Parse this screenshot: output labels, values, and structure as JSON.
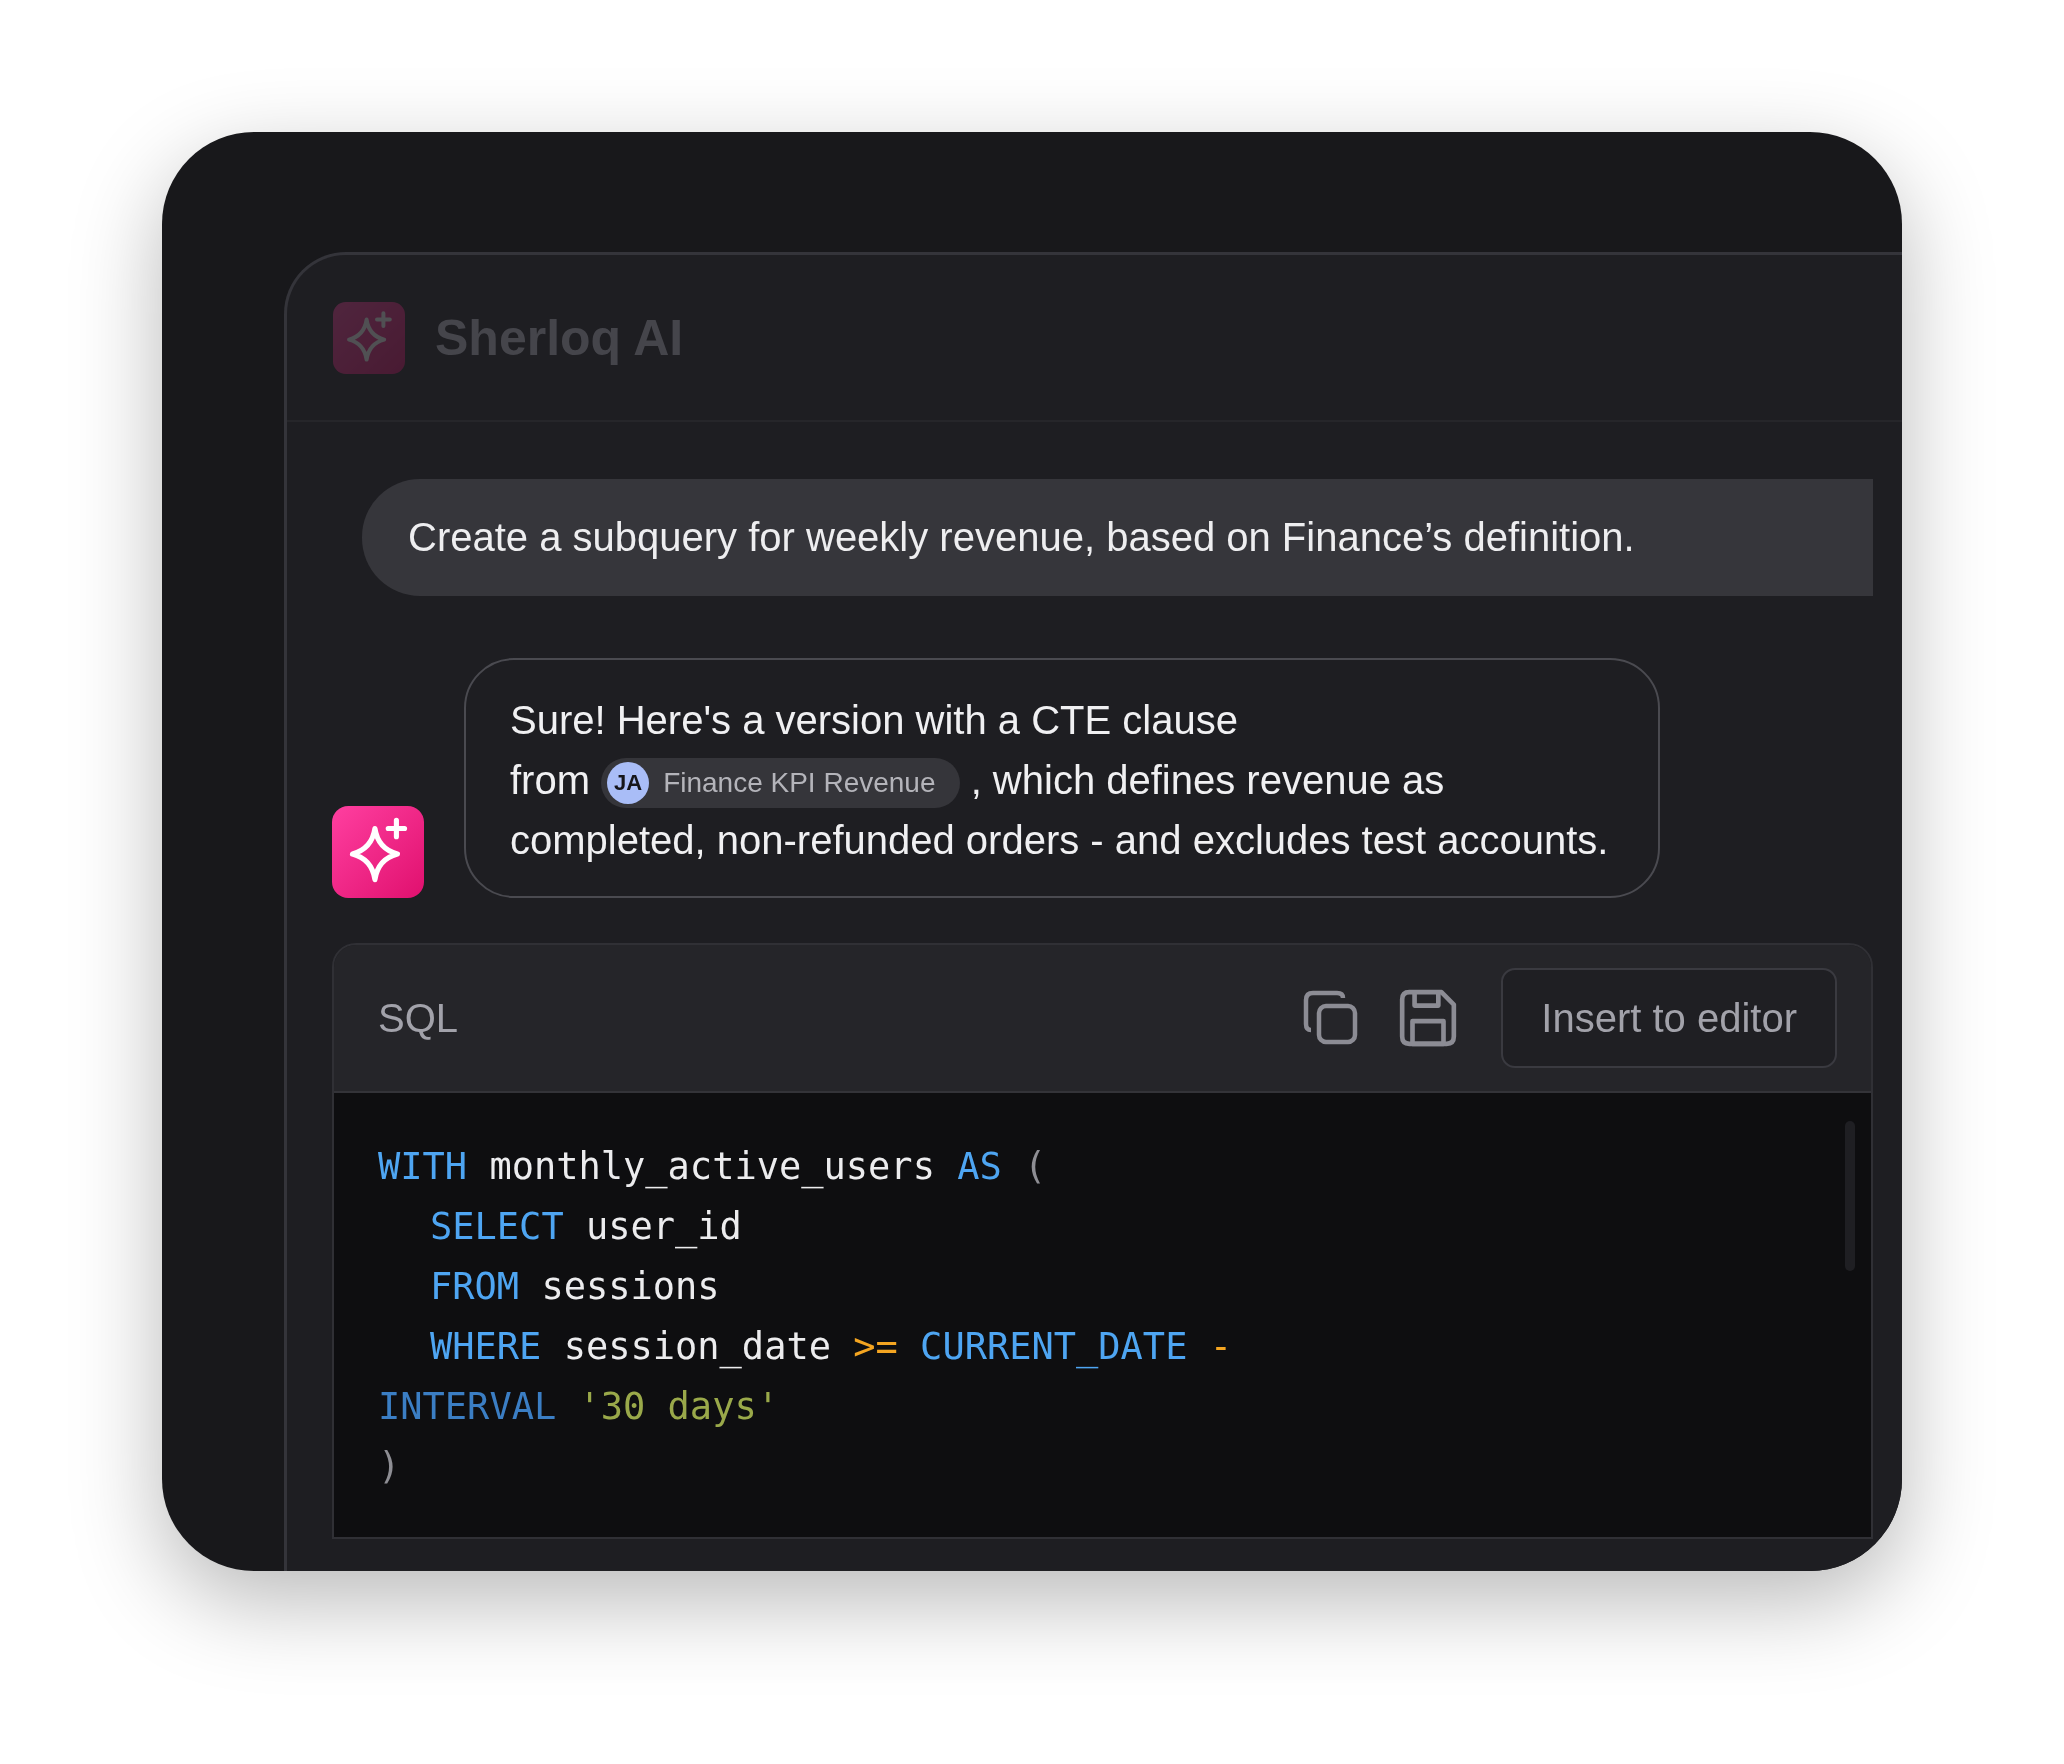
{
  "header": {
    "title": "Sherloq AI",
    "dimmed": true
  },
  "user_message": {
    "text": "Create a subquery for weekly revenue, based on Finance’s definition."
  },
  "ai_message": {
    "segments": [
      {
        "kind": "text",
        "text": "Sure! Here's a version with a CTE clause\nfrom "
      },
      {
        "kind": "chip",
        "initials": "JA",
        "text": "Finance KPI Revenue"
      },
      {
        "kind": "text",
        "text": " , which defines revenue as completed, non-refunded orders - and excludes test accounts."
      }
    ]
  },
  "code_block": {
    "language": "SQL",
    "insert_button": "Insert to editor",
    "lines": [
      {
        "indented": false,
        "tokens": [
          {
            "kind": "keyword",
            "text": "WITH"
          },
          {
            "kind": "ident",
            "text": " monthly_active_users "
          },
          {
            "kind": "keyword",
            "text": "AS"
          },
          {
            "kind": "punct",
            "text": " ("
          }
        ]
      },
      {
        "indented": true,
        "tokens": [
          {
            "kind": "keyword",
            "text": "SELECT"
          },
          {
            "kind": "ident",
            "text": " user_id"
          }
        ]
      },
      {
        "indented": true,
        "tokens": [
          {
            "kind": "keyword",
            "text": "FROM"
          },
          {
            "kind": "ident",
            "text": " sessions"
          }
        ]
      },
      {
        "indented": true,
        "tokens": [
          {
            "kind": "keyword",
            "text": "WHERE"
          },
          {
            "kind": "ident",
            "text": " session_date "
          },
          {
            "kind": "operator",
            "text": ">="
          },
          {
            "kind": "keyword",
            "text": " CURRENT_DATE "
          },
          {
            "kind": "operator",
            "text": "-"
          }
        ]
      },
      {
        "indented": false,
        "tokens": [
          {
            "kind": "type",
            "text": "INTERVAL"
          },
          {
            "kind": "string",
            "text": " '30 days'"
          }
        ]
      },
      {
        "indented": false,
        "tokens": [
          {
            "kind": "punct",
            "text": ")"
          }
        ]
      }
    ]
  }
}
